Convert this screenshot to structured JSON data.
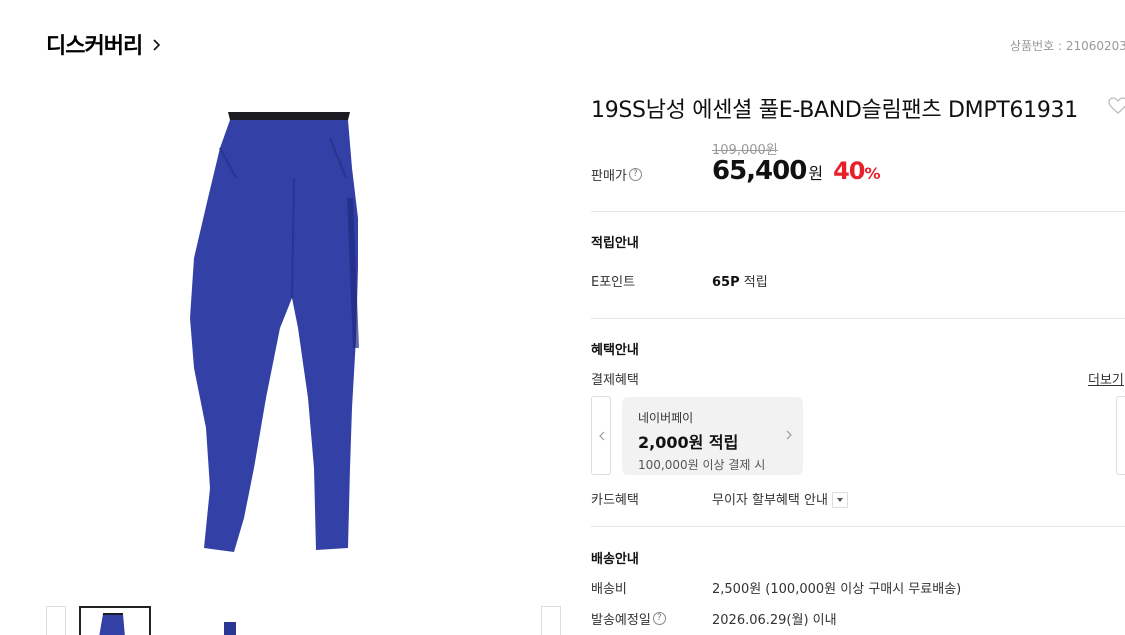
{
  "brand": {
    "name": "디스커버리"
  },
  "product_no": "상품번호 : 21060203",
  "product": {
    "title": "19SS남성 에센셜 풀E-BAND슬림팬츠 DMPT61931",
    "color": "#3341a6"
  },
  "price": {
    "label": "판매가",
    "help": "?",
    "original": "109,000원",
    "sale": "65,400",
    "won": "원",
    "discount": "40",
    "percent": "%"
  },
  "points": {
    "title": "적립안내",
    "label": "E포인트",
    "value_bold": "65P",
    "value_suffix": " 적립"
  },
  "benefits": {
    "title": "혜택안내",
    "payment_label": "결제혜택",
    "more": "더보기",
    "card": {
      "provider": "네이버페이",
      "amount": "2,000원 적립",
      "condition": "100,000원 이상 결제 시"
    },
    "card_label": "카드혜택",
    "card_value": "무이자 할부혜택 안내"
  },
  "delivery": {
    "title": "배송안내",
    "fee_label": "배송비",
    "fee_value": "2,500원 (100,000원 이상 구매시 무료배송)",
    "date_label": "발송예정일",
    "date_value": "2026.06.29(월) 이내"
  },
  "colors": {
    "accent_red": "#e8202a",
    "divider": "#e5e5e5"
  }
}
